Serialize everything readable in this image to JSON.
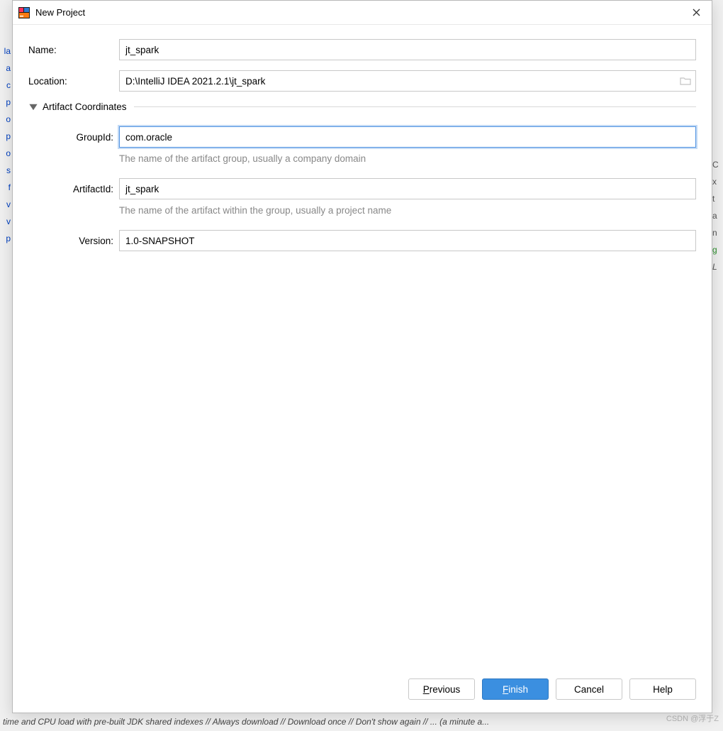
{
  "dialog": {
    "title": "New Project"
  },
  "form": {
    "name_label": "Name:",
    "name_value": "jt_spark",
    "location_label": "Location:",
    "location_value": "D:\\IntelliJ IDEA 2021.2.1\\jt_spark",
    "section_title": "Artifact Coordinates",
    "groupid_label": "GroupId:",
    "groupid_value": "com.oracle",
    "groupid_help": "The name of the artifact group, usually a company domain",
    "artifactid_label": "ArtifactId:",
    "artifactid_value": "jt_spark",
    "artifactid_help": "The name of the artifact within the group, usually a project name",
    "version_label": "Version:",
    "version_value": "1.0-SNAPSHOT"
  },
  "buttons": {
    "previous": "Previous",
    "finish": "Finish",
    "cancel": "Cancel",
    "help": "Help"
  },
  "bg": {
    "left": [
      "la",
      "",
      "a",
      "",
      "",
      "c",
      "p",
      "o",
      "",
      "",
      "",
      "p",
      "o",
      "",
      "s",
      "",
      "",
      "f",
      "v",
      "v",
      "p"
    ],
    "right": [
      "",
      "C",
      "",
      "",
      "x",
      "",
      "",
      "",
      "",
      "t",
      "a",
      "",
      "",
      "",
      "",
      "n",
      "",
      "",
      "g",
      "L"
    ]
  },
  "watermark": "CSDN @浮于Z",
  "bottom_text": "time and CPU load with pre-built JDK shared indexes // Always download // Download once // Don't show again // ... (a minute a..."
}
